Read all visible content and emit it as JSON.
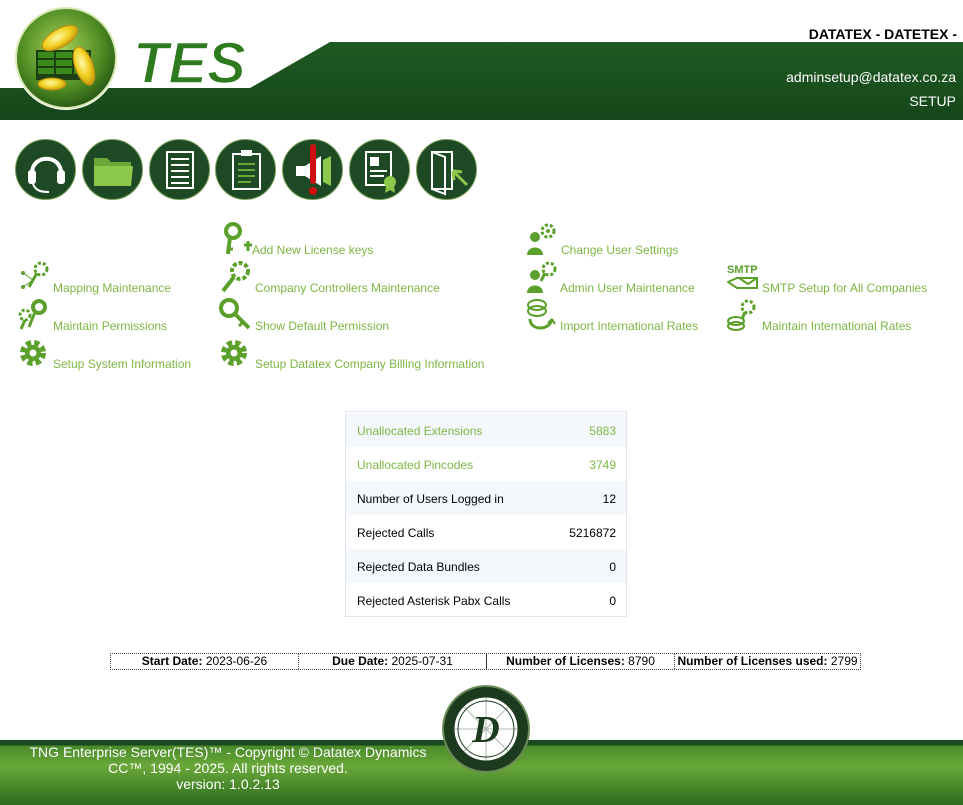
{
  "header": {
    "logo_text": "TES",
    "company": "DATATEX - DATETEX -",
    "email": "adminsetup@datatex.co.za",
    "role": "SETUP"
  },
  "toolbar": {
    "buttons": [
      {
        "name": "headset-icon"
      },
      {
        "name": "folder-icon"
      },
      {
        "name": "document-list-icon"
      },
      {
        "name": "clipboard-icon"
      },
      {
        "name": "megaphone-alert-icon"
      },
      {
        "name": "certificate-icon"
      },
      {
        "name": "logout-door-icon"
      }
    ]
  },
  "menu": {
    "add_license_keys": "Add New License keys",
    "change_user_settings": "Change User Settings",
    "mapping_maintenance": "Mapping Maintenance",
    "company_controllers_maintenance": "Company Controllers Maintenance",
    "admin_user_maintenance": "Admin User Maintenance",
    "smtp_setup": "SMTP Setup for All Companies",
    "smtp_icon_text": "SMTP",
    "maintain_permissions": "Maintain Permissions",
    "show_default_permission": "Show Default Permission",
    "import_international_rates": "Import International Rates",
    "maintain_international_rates": "Maintain International Rates",
    "setup_system_information": "Setup System Information",
    "setup_billing_information": "Setup Datatex Company Billing Information"
  },
  "stats": [
    {
      "label": "Unallocated Extensions",
      "value": "5883"
    },
    {
      "label": "Unallocated Pincodes",
      "value": "3749"
    },
    {
      "label": "Number of Users Logged in",
      "value": "12"
    },
    {
      "label": "Rejected Calls",
      "value": "5216872"
    },
    {
      "label": "Rejected Data Bundles",
      "value": "0"
    },
    {
      "label": "Rejected Asterisk Pabx Calls",
      "value": "0"
    }
  ],
  "license": {
    "start_label": "Start Date:",
    "start_value": "2023-06-26",
    "due_label": "Due Date:",
    "due_value": "2025-07-31",
    "num_label": "Number of Licenses:",
    "num_value": "8790",
    "used_label": "Number of Licenses used:",
    "used_value": "2799"
  },
  "footer": {
    "line1": "TNG Enterprise Server(TES)™ - Copyright © Datatex Dynamics",
    "line2": "CC™, 1994 - 2025. All rights reserved.",
    "line3": "version: 1.0.2.13",
    "logo_letter": "D"
  },
  "colors": {
    "dark_green": "#1b4a20",
    "accent_green": "#7db743",
    "stat_alt_bg": "#f4f8fc"
  }
}
